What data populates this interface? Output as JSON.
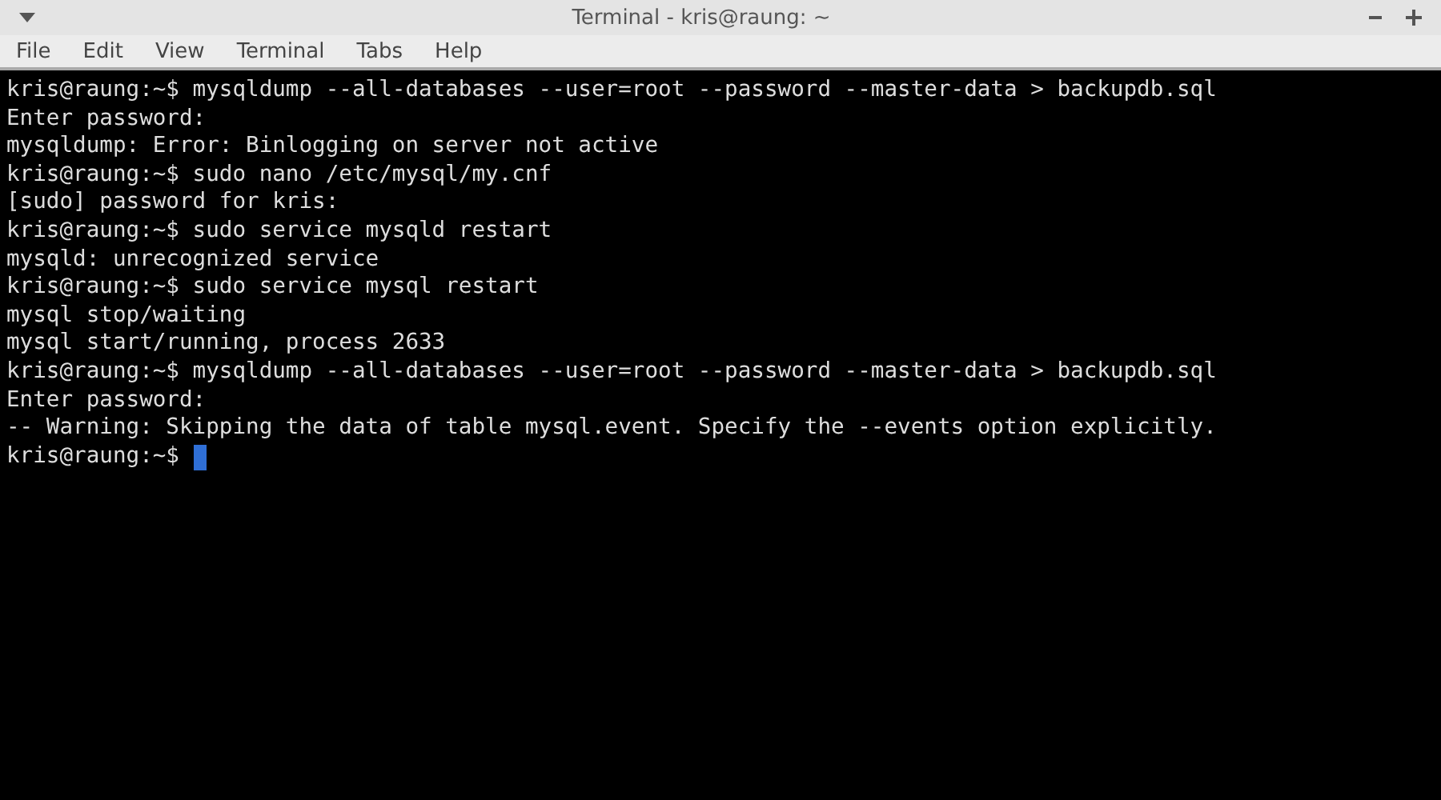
{
  "window": {
    "title": "Terminal - kris@raung: ~"
  },
  "menu": [
    "File",
    "Edit",
    "View",
    "Terminal",
    "Tabs",
    "Help"
  ],
  "lines": [
    {
      "text": "kris@raung:~$ mysqldump --all-databases --user=root --password --master-data > backupdb.sql",
      "cursor": false
    },
    {
      "text": "Enter password:",
      "cursor": false
    },
    {
      "text": "mysqldump: Error: Binlogging on server not active",
      "cursor": false
    },
    {
      "text": "kris@raung:~$ sudo nano /etc/mysql/my.cnf",
      "cursor": false
    },
    {
      "text": "[sudo] password for kris:",
      "cursor": false
    },
    {
      "text": "kris@raung:~$ sudo service mysqld restart",
      "cursor": false
    },
    {
      "text": "mysqld: unrecognized service",
      "cursor": false
    },
    {
      "text": "kris@raung:~$ sudo service mysql restart",
      "cursor": false
    },
    {
      "text": "mysql stop/waiting",
      "cursor": false
    },
    {
      "text": "mysql start/running, process 2633",
      "cursor": false
    },
    {
      "text": "kris@raung:~$ mysqldump --all-databases --user=root --password --master-data > backupdb.sql",
      "cursor": false
    },
    {
      "text": "Enter password:",
      "cursor": false
    },
    {
      "text": "-- Warning: Skipping the data of table mysql.event. Specify the --events option explicitly.",
      "cursor": false
    },
    {
      "text": "kris@raung:~$",
      "cursor": true
    }
  ]
}
